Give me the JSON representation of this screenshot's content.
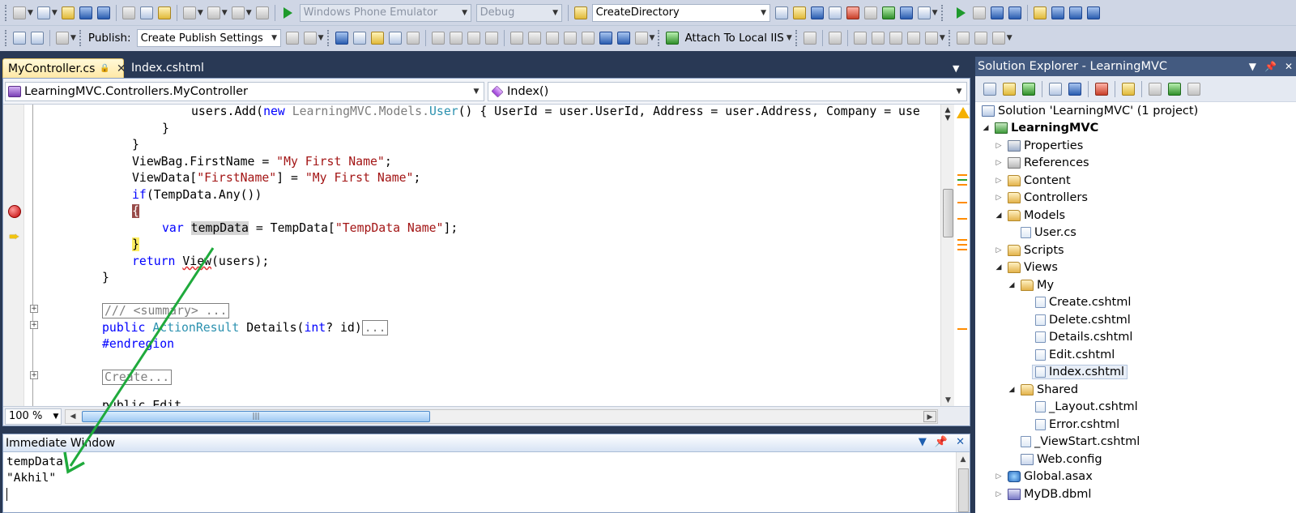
{
  "toolbar": {
    "device_combo": "Windows Phone Emulator",
    "config_combo": "Debug",
    "find_combo": "CreateDirectory",
    "publish_label": "Publish:",
    "publish_combo": "Create Publish Settings",
    "attach_label": "Attach To Local IIS"
  },
  "tabs": [
    {
      "label": "MyController.cs"
    },
    {
      "label": "Index.cshtml"
    }
  ],
  "editor": {
    "class_combo": "LearningMVC.Controllers.MyController",
    "member_combo": "Index()",
    "zoom": "100 %",
    "code": {
      "l1_a": "users.Add(",
      "l1_new": "new",
      "l1_b": " LearningMVC.Models.",
      "l1_type": "User",
      "l1_c": "() { UserId = user.UserId, Address = user.Address, Company = use",
      "l2": "}",
      "l3": "}",
      "l4_a": "ViewBag.FirstName = ",
      "l4_str": "\"My First Name\"",
      "l4_b": ";",
      "l5_a": "ViewData[",
      "l5_key": "\"FirstName\"",
      "l5_b": "] = ",
      "l5_str": "\"My First Name\"",
      "l5_c": ";",
      "l6_if": "if",
      "l6_b": "(TempData.Any())",
      "l7": "{",
      "l8_var": "var",
      "l8_ident": "tempData",
      "l8_b": " = TempData[",
      "l8_str": "\"TempData Name\"",
      "l8_c": "];",
      "l9": "}",
      "l10_ret": "return",
      "l10_view": "View",
      "l10_b": "(users);",
      "l11": "}",
      "l13_summary": "/// <summary> ...",
      "l14_public": "public",
      "l14_type": "ActionResult",
      "l14_b": " Details(",
      "l14_int": "int",
      "l14_c": "? id)",
      "l14_ell": "...",
      "l15": "#endregion",
      "l17": "Create...",
      "l19": "public Edit"
    }
  },
  "immediate": {
    "title": "Immediate Window",
    "line1": "tempData",
    "line2": "\"Akhil\""
  },
  "solution_explorer": {
    "title": "Solution Explorer - LearningMVC",
    "items": [
      {
        "label": "Solution 'LearningMVC' (1 project)",
        "icon": "solution-icon"
      },
      {
        "label": "LearningMVC",
        "icon": "project-icon"
      },
      {
        "label": "Properties",
        "icon": "properties-icon"
      },
      {
        "label": "References",
        "icon": "references-icon"
      },
      {
        "label": "Content",
        "icon": "folder-icon"
      },
      {
        "label": "Controllers",
        "icon": "folder-icon"
      },
      {
        "label": "Models",
        "icon": "folder-icon"
      },
      {
        "label": "User.cs",
        "icon": "cs-file-icon"
      },
      {
        "label": "Scripts",
        "icon": "folder-icon"
      },
      {
        "label": "Views",
        "icon": "folder-icon"
      },
      {
        "label": "My",
        "icon": "folder-icon"
      },
      {
        "label": "Create.cshtml",
        "icon": "cshtml-file-icon"
      },
      {
        "label": "Delete.cshtml",
        "icon": "cshtml-file-icon"
      },
      {
        "label": "Details.cshtml",
        "icon": "cshtml-file-icon"
      },
      {
        "label": "Edit.cshtml",
        "icon": "cshtml-file-icon"
      },
      {
        "label": "Index.cshtml",
        "icon": "cshtml-file-icon"
      },
      {
        "label": "Shared",
        "icon": "folder-icon"
      },
      {
        "label": "_Layout.cshtml",
        "icon": "cshtml-file-icon"
      },
      {
        "label": "Error.cshtml",
        "icon": "cshtml-file-icon"
      },
      {
        "label": "_ViewStart.cshtml",
        "icon": "cshtml-file-icon"
      },
      {
        "label": "Web.config",
        "icon": "config-file-icon"
      },
      {
        "label": "Global.asax",
        "icon": "global-asax-icon"
      },
      {
        "label": "MyDB.dbml",
        "icon": "dbml-file-icon"
      }
    ]
  },
  "colors": {
    "ide_background": "#293955",
    "annotation_arrow": "#1faa3c",
    "breakpoint": "#c00000",
    "current_line": "#ffee62"
  }
}
